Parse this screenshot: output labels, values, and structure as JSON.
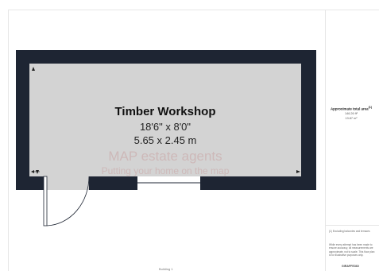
{
  "room": {
    "name": "Timber Workshop",
    "dim_imperial": "18'6\" x 8'0\"",
    "dim_metric": "5.65 x 2.45 m"
  },
  "watermark": {
    "line1": "MAP estate agents",
    "line2": "Putting your home on the map"
  },
  "sidebar": {
    "title": "Approximate total area",
    "title_sup": "(1)",
    "area_sqft": "146.26 ft²",
    "area_sqm": "13.87 m²",
    "note1": "(1) Excluding balconies and terraces",
    "note2": "While every attempt has been made to ensure accuracy, all measurements are approximate, not to scale. This floor plan is for illustrative purposes only.",
    "brand": "GIRAFFE360"
  },
  "footer": {
    "label": "Building 1"
  },
  "colors": {
    "wall": "#1e2533",
    "floor": "#d3d3d3",
    "watermark": "#c9a3a3"
  }
}
